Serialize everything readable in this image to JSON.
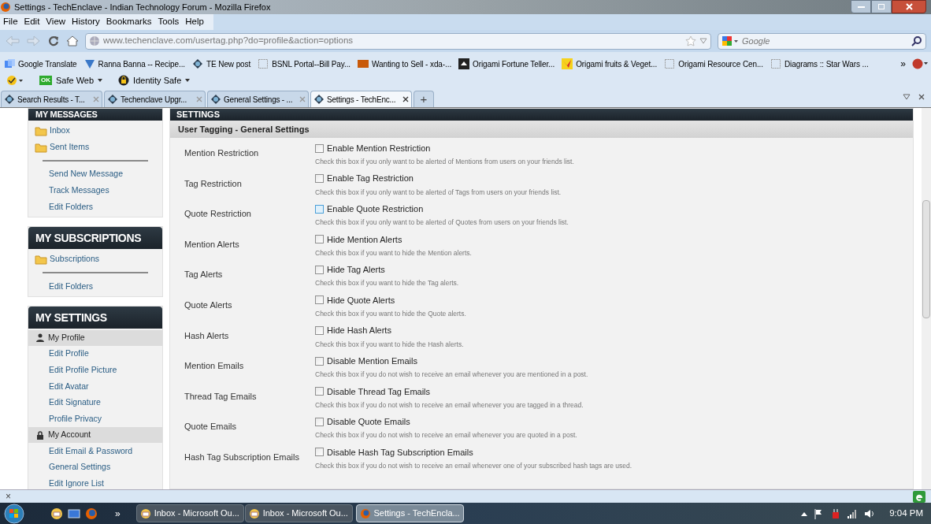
{
  "window": {
    "title": "Settings - TechEnclave - Indian Technology Forum - Mozilla Firefox"
  },
  "menu": [
    "File",
    "Edit",
    "View",
    "History",
    "Bookmarks",
    "Tools",
    "Help"
  ],
  "navigation": {
    "url": "www.techenclave.com/usertag.php?do=profile&action=options",
    "search_placeholder": "Google"
  },
  "bookmarks": [
    {
      "label": "Google Translate",
      "kind": "translate"
    },
    {
      "label": "Ranna Banna -- Recipe...",
      "kind": "check"
    },
    {
      "label": "TE New post",
      "kind": "te"
    },
    {
      "label": "BSNL Portal--Bill Pay...",
      "kind": "blank"
    },
    {
      "label": "Wanting to Sell - xda-...",
      "kind": "xda"
    },
    {
      "label": "Origami Fortune Teller...",
      "kind": "bird"
    },
    {
      "label": "Origami fruits & Veget...",
      "kind": "crane"
    },
    {
      "label": "Origami Resource Cen...",
      "kind": "blank"
    },
    {
      "label": "Diagrams :: Star Wars ...",
      "kind": "blank"
    }
  ],
  "bookmarks_more": "»",
  "addon_toolbar": [
    {
      "label": "Safe Web",
      "badge": "OK"
    },
    {
      "label": "Identity Safe"
    }
  ],
  "tabs": [
    {
      "label": "Search Results - T...",
      "selected": false
    },
    {
      "label": "Techenclave Upgr...",
      "selected": false
    },
    {
      "label": "General Settings - ...",
      "selected": false
    },
    {
      "label": "Settings - TechEnc...",
      "selected": true
    }
  ],
  "new_tab": "+",
  "sidebar": [
    {
      "heading": "MY MESSAGES",
      "items": [
        {
          "kind": "folder",
          "label": "Inbox"
        },
        {
          "kind": "folder",
          "label": "Sent Items"
        },
        {
          "kind": "divider"
        },
        {
          "kind": "link",
          "label": "Send New Message"
        },
        {
          "kind": "link",
          "label": "Track Messages"
        },
        {
          "kind": "link",
          "label": "Edit Folders"
        }
      ]
    },
    {
      "heading": "MY SUBSCRIPTIONS",
      "items": [
        {
          "kind": "folder",
          "label": "Subscriptions"
        },
        {
          "kind": "divider"
        },
        {
          "kind": "link",
          "label": "Edit Folders"
        }
      ]
    },
    {
      "heading": "MY SETTINGS",
      "items": [
        {
          "kind": "profile_group",
          "label": "My Profile"
        },
        {
          "kind": "link",
          "label": "Edit Profile"
        },
        {
          "kind": "link",
          "label": "Edit Profile Picture"
        },
        {
          "kind": "link",
          "label": "Edit Avatar"
        },
        {
          "kind": "link",
          "label": "Edit Signature"
        },
        {
          "kind": "link",
          "label": "Profile Privacy"
        },
        {
          "kind": "account_group",
          "label": "My Account"
        },
        {
          "kind": "link",
          "label": "Edit Email & Password"
        },
        {
          "kind": "link",
          "label": "General Settings"
        },
        {
          "kind": "link",
          "label": "Edit Ignore List"
        }
      ]
    }
  ],
  "main": {
    "heading": "SETTINGS",
    "section": "User Tagging - General Settings",
    "settings": [
      {
        "label": "Mention Restriction",
        "option": "Enable Mention Restriction",
        "description": "Check this box if you only want to be alerted of Mentions from users on your friends list.",
        "checked": false,
        "hovered": false
      },
      {
        "label": "Tag Restriction",
        "option": "Enable Tag Restriction",
        "description": "Check this box if you only want to be alerted of Tags from users on your friends list.",
        "checked": false,
        "hovered": false
      },
      {
        "label": "Quote Restriction",
        "option": "Enable Quote Restriction",
        "description": "Check this box if you only want to be alerted of Quotes from users on your friends list.",
        "checked": false,
        "hovered": true
      },
      {
        "label": "Mention Alerts",
        "option": "Hide Mention Alerts",
        "description": "Check this box if you want to hide the Mention alerts.",
        "checked": false,
        "hovered": false
      },
      {
        "label": "Tag Alerts",
        "option": "Hide Tag Alerts",
        "description": "Check this box if you want to hide the Tag alerts.",
        "checked": false,
        "hovered": false
      },
      {
        "label": "Quote Alerts",
        "option": "Hide Quote Alerts",
        "description": "Check this box if you want to hide the Quote alerts.",
        "checked": false,
        "hovered": false
      },
      {
        "label": "Hash Alerts",
        "option": "Hide Hash Alerts",
        "description": "Check this box if you want to hide the Hash alerts.",
        "checked": false,
        "hovered": false
      },
      {
        "label": "Mention Emails",
        "option": "Disable Mention Emails",
        "description": "Check this box if you do not wish to receive an email whenever you are mentioned in a post.",
        "checked": false,
        "hovered": false
      },
      {
        "label": "Thread Tag Emails",
        "option": "Disable Thread Tag Emails",
        "description": "Check this box if you do not wish to receive an email whenever you are tagged in a thread.",
        "checked": false,
        "hovered": false
      },
      {
        "label": "Quote Emails",
        "option": "Disable Quote Emails",
        "description": "Check this box if you do not wish to receive an email whenever you are quoted in a post.",
        "checked": false,
        "hovered": false
      },
      {
        "label": "Hash Tag Subscription Emails",
        "option": "Disable Hash Tag Subscription Emails",
        "description": "Check this box if you do not wish to receive an email whenever one of your subscribed hash tags are used.",
        "checked": false,
        "hovered": false
      }
    ]
  },
  "addon_bar": {
    "close": "×"
  },
  "taskbar": {
    "more": "»",
    "tasks": [
      {
        "label": "Inbox - Microsoft Ou...",
        "kind": "outlook",
        "selected": false
      },
      {
        "label": "Inbox - Microsoft Ou...",
        "kind": "outlook",
        "selected": false
      },
      {
        "label": "Settings - TechEncla...",
        "kind": "firefox",
        "selected": true
      }
    ],
    "clock": "9:04 PM"
  }
}
